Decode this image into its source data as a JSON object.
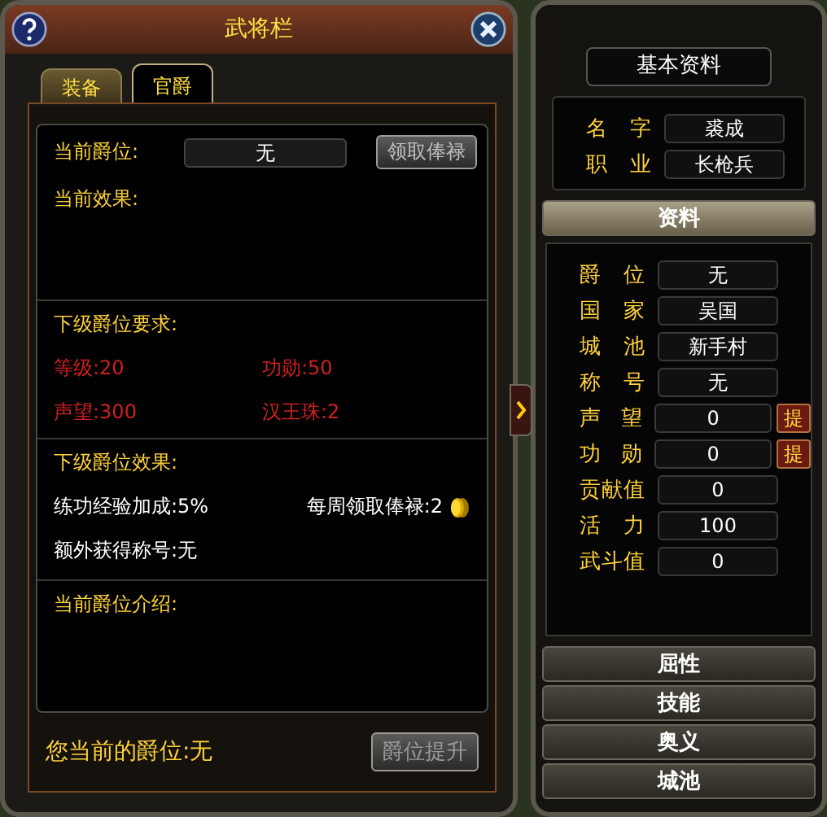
{
  "window": {
    "title": "武将栏"
  },
  "tabs": [
    {
      "label": "装备",
      "selected": false
    },
    {
      "label": "官爵",
      "selected": true
    }
  ],
  "current_rank": {
    "label": "当前爵位:",
    "value": "无",
    "button": "领取俸禄"
  },
  "current_effect": {
    "heading": "当前效果:"
  },
  "next_requirements": {
    "heading": "下级爵位要求:",
    "items": [
      {
        "text": "等级:20",
        "met": false
      },
      {
        "text": "功勋:50",
        "met": false
      },
      {
        "text": "声望:300",
        "met": false
      },
      {
        "text": "汉王珠:2",
        "met": false
      }
    ]
  },
  "next_effects": {
    "heading": "下级爵位效果:",
    "items": [
      {
        "text": "练功经验加成:5%",
        "kind": "text"
      },
      {
        "text": "每周领取俸禄:2",
        "kind": "coin"
      },
      {
        "text": "额外获得称号:无",
        "kind": "text"
      }
    ]
  },
  "rank_intro": {
    "heading": "当前爵位介绍:"
  },
  "footer": {
    "text": "您当前的爵位:无",
    "button": "爵位提升",
    "button_disabled": true
  },
  "profile": {
    "title": "基本资料",
    "fields": [
      {
        "label": "名 字",
        "value": "裘成"
      },
      {
        "label": "职 业",
        "value": "长枪兵"
      }
    ]
  },
  "sections": [
    {
      "label": "资料",
      "expanded": true,
      "fields": [
        {
          "label": "爵 位",
          "value": "无"
        },
        {
          "label": "国 家",
          "value": "吴国"
        },
        {
          "label": "城 池",
          "value": "新手村"
        },
        {
          "label": "称 号",
          "value": "无"
        },
        {
          "label": "声 望",
          "value": "0",
          "action": "提"
        },
        {
          "label": "功 勋",
          "value": "0",
          "action": "提"
        },
        {
          "label": "贡献值",
          "value": "0"
        },
        {
          "label": "活 力",
          "value": "100"
        },
        {
          "label": "武斗值",
          "value": "0"
        }
      ]
    },
    {
      "label": "屈性",
      "expanded": false
    },
    {
      "label": "技能",
      "expanded": false
    },
    {
      "label": "奥义",
      "expanded": false
    },
    {
      "label": "城池",
      "expanded": false
    }
  ]
}
